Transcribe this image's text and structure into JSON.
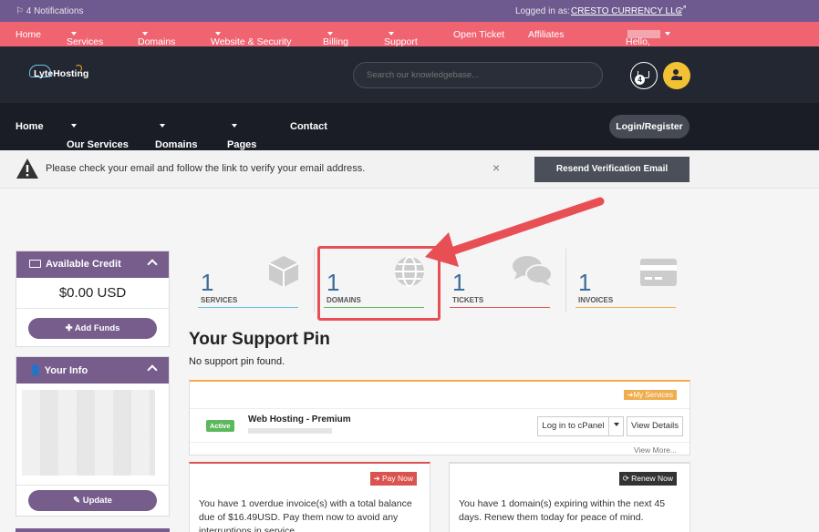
{
  "admin_bar": {
    "notifications": "4 Notifications",
    "logged_in_as": "Logged in as:",
    "company": "CRESTO CURRENCY LLC"
  },
  "top_nav": {
    "items": [
      "Home",
      "Services",
      "Domains",
      "Website & Security",
      "Billing",
      "Support",
      "Open Ticket",
      "Affiliates"
    ],
    "greeting": "Hello,"
  },
  "header": {
    "logo_text": "LyteHosting",
    "search_placeholder": "Search our knowledgebase...",
    "cart_count": "4"
  },
  "main_nav": {
    "items": [
      "Home",
      "Our Services",
      "Domains",
      "Pages",
      "Contact"
    ],
    "login": "Login/Register"
  },
  "verify_alert": {
    "message": "Please check your email and follow the link to verify your email address.",
    "close": "×",
    "button": "Resend Verification Email"
  },
  "sidebar": {
    "credit_title": "Available Credit",
    "credit_amount": "$0.00 USD",
    "add_funds": "Add Funds",
    "info_title": "Your Info",
    "update": "Update"
  },
  "stats": [
    {
      "value": "1",
      "label": "SERVICES",
      "color": "#5bc0de"
    },
    {
      "value": "1",
      "label": "DOMAINS",
      "color": "#5cb85c"
    },
    {
      "value": "1",
      "label": "TICKETS",
      "color": "#d9534f"
    },
    {
      "value": "1",
      "label": "INVOICES",
      "color": "#f0ad4e"
    }
  ],
  "support_pin": {
    "title": "Your Support Pin",
    "text": "No support pin found."
  },
  "services_panel": {
    "my_services": "My Services",
    "status": "Active",
    "product": "Web Hosting - Premium",
    "login_cpanel": "Log in to cPanel",
    "view_details": "View Details",
    "view_more": "View More..."
  },
  "overdue": {
    "button": "Pay Now",
    "text": "You have 1 overdue invoice(s) with a total balance due of $16.49USD. Pay them now to avoid any interruptions in service."
  },
  "renewals": {
    "button": "Renew Now",
    "text": "You have 1 domain(s) expiring within the next 45 days. Renew them today for peace of mind."
  },
  "colors": {
    "accent": "#765d8c",
    "pink": "#f06472",
    "dark": "#232731",
    "highlight": "#e84f55"
  }
}
